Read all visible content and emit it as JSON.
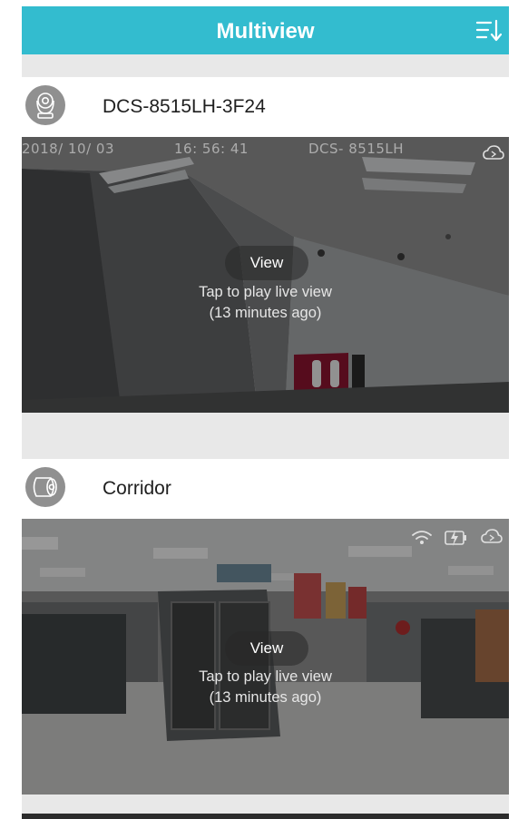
{
  "app": {
    "title": "Multiview"
  },
  "header": {
    "sort_icon": "list-sort-icon"
  },
  "cameras": [
    {
      "name": "DCS-8515LH-3F24",
      "icon": "pan-tilt-camera-icon",
      "view_label": "View",
      "tap_text": "Tap to play live view",
      "last_updated": "(13 minutes ago)",
      "osd_date": "2018/ 10/ 03",
      "osd_time": "16: 56: 41",
      "osd_model": "DCS- 8515LH",
      "status_icons": [
        "cloud-icon"
      ]
    },
    {
      "name": "Corridor",
      "icon": "wide-angle-camera-icon",
      "view_label": "View",
      "tap_text": "Tap to play live view",
      "last_updated": "(13 minutes ago)",
      "status_icons": [
        "wifi-icon",
        "power-adapter-icon",
        "cloud-icon"
      ]
    }
  ],
  "colors": {
    "header": "#33bccf",
    "background": "#e8e8e8"
  }
}
